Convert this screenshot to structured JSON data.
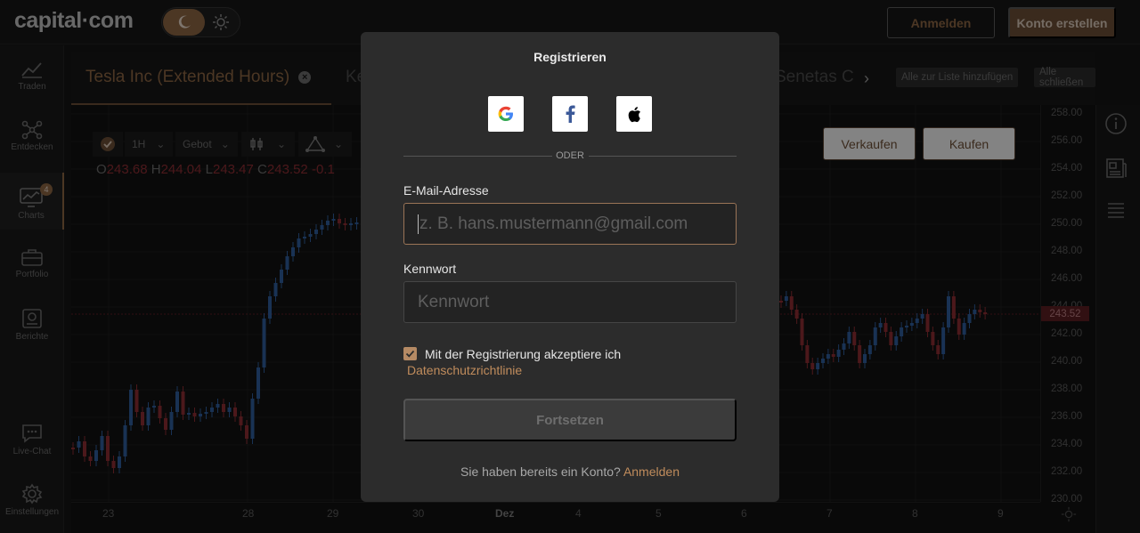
{
  "header": {
    "logo": "capital·com",
    "login_label": "Anmelden",
    "create_account_label": "Konto erstellen"
  },
  "sidebar": {
    "items": [
      {
        "label": "Traden",
        "icon": "trend-icon"
      },
      {
        "label": "Entdecken",
        "icon": "network-icon"
      },
      {
        "label": "Charts",
        "icon": "chart-monitor-icon",
        "badge": "4"
      },
      {
        "label": "Portfolio",
        "icon": "briefcase-icon"
      },
      {
        "label": "Berichte",
        "icon": "report-icon"
      },
      {
        "label": "Live-Chat",
        "icon": "chat-icon"
      },
      {
        "label": "Einstellungen",
        "icon": "gear-icon"
      }
    ]
  },
  "tabs": {
    "active": "Tesla Inc (Extended Hours)",
    "partial_left": "Ke",
    "partial_right": "Senetas C",
    "add_to_list": "Alle zur Liste hinzufügen",
    "close_all": "Alle schließen"
  },
  "chart_toolbar": {
    "interval": "1H",
    "price_type": "Gebot"
  },
  "ohlc": {
    "o_label": "O",
    "o": "243.68",
    "h_label": "H",
    "h": "244.04",
    "l_label": "L",
    "l": "243.47",
    "c_label": "C",
    "c": "243.52",
    "change": "-0.1"
  },
  "trade": {
    "sell_label": "Verkaufen",
    "buy_label": "Kaufen"
  },
  "price_axis": [
    "258.00",
    "256.00",
    "254.00",
    "252.00",
    "250.00",
    "248.00",
    "246.00",
    "244.00",
    "242.00",
    "240.00",
    "238.00",
    "236.00",
    "234.00",
    "232.00",
    "230.00"
  ],
  "current_price": "243.52",
  "time_axis": [
    "23",
    "28",
    "29",
    "30",
    "Dez",
    "4",
    "5",
    "6",
    "7",
    "8",
    "9"
  ],
  "modal": {
    "title": "Registrieren",
    "or_label": "ODER",
    "email_label": "E-Mail-Adresse",
    "email_placeholder": "z. B. hans.mustermann@gmail.com",
    "password_label": "Kennwort",
    "password_placeholder": "Kennwort",
    "consent_text": "Mit der Registrierung akzeptiere ich",
    "privacy_link": "Datenschutzrichtlinie",
    "continue_label": "Fortsetzen",
    "have_account_text": "Sie haben bereits ein Konto?",
    "login_link": "Anmelden"
  },
  "colors": {
    "accent": "#8a6443",
    "bull": "#2e5b9a",
    "bear": "#8a2c32"
  }
}
